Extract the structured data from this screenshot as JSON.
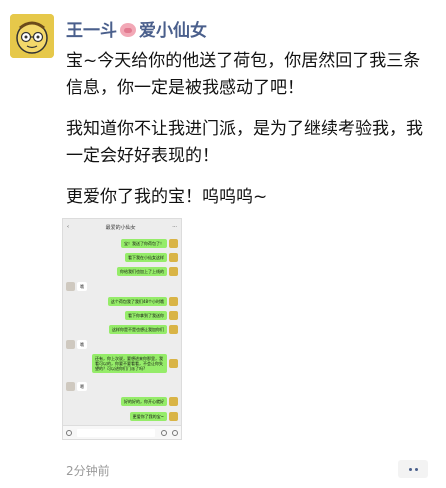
{
  "post": {
    "author": "王一斗",
    "author_suffix": "爱小仙女",
    "paragraphs": [
      "宝~今天给你的他送了荷包，你居然回了我三条信息，你一定是被我感动了吧！",
      "我知道你不让我进门派，是为了继续考验我，我一定会好好表现的！",
      "更爱你了我的宝！呜呜呜~"
    ],
    "time": "2分钟前"
  },
  "screenshot": {
    "title": "最爱的小仙女",
    "messages": [
      {
        "side": "me",
        "text": "宝！我送了你荷包了！"
      },
      {
        "side": "me",
        "text": "看下我在小仙女这样"
      },
      {
        "side": "me",
        "text": "你给我们也加上了上线的"
      },
      {
        "side": "her",
        "text": "哦"
      },
      {
        "side": "me",
        "text": "这个荷包我了我们48个小时哦"
      },
      {
        "side": "me",
        "text": "看下你拿到了我送你"
      },
      {
        "side": "me",
        "text": "这样你是不是也想让我加你们"
      },
      {
        "side": "her",
        "text": "哦"
      },
      {
        "side": "me",
        "text": "还有，你上次说，要想进来你那里，我看可以的，你要不要看看，不会让你失望的？可以进你们门派了吗?"
      },
      {
        "side": "her",
        "text": "嗯"
      },
      {
        "side": "me",
        "text": "好的好的，你开心就好"
      },
      {
        "side": "me",
        "text": "更爱你了我的宝~"
      }
    ]
  },
  "icons": {
    "avatar": "avatar-cartoon",
    "pig": "pig-emoji",
    "more": "more-dots-icon"
  },
  "colors": {
    "name": "#4a5f8c",
    "my_bubble": "#95ec69"
  }
}
